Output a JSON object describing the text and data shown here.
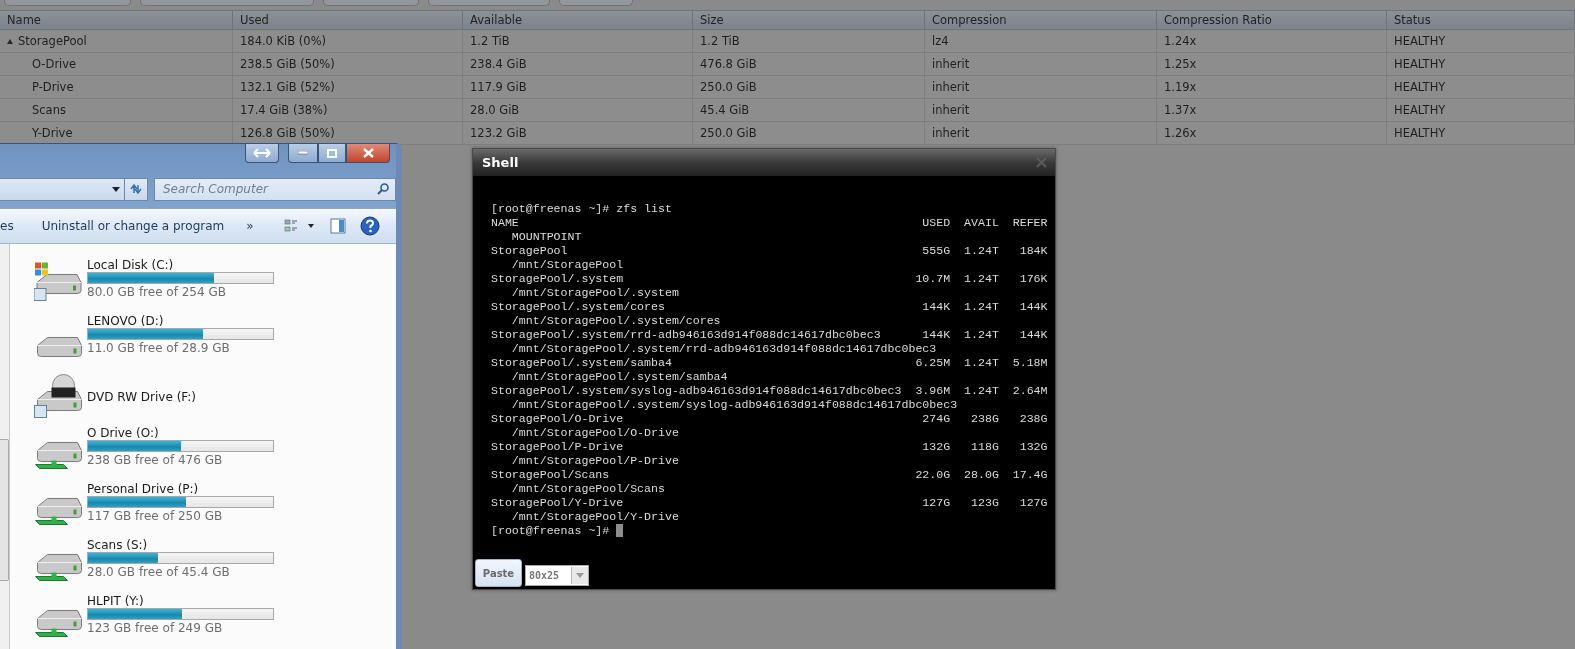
{
  "volumes_table": {
    "columns": [
      "Name",
      "Used",
      "Available",
      "Size",
      "Compression",
      "Compression Ratio",
      "Status"
    ],
    "rows": [
      {
        "cells": [
          "StoragePool",
          "184.0 KiB (0%)",
          "1.2 TiB",
          "1.2 TiB",
          "lz4",
          "1.24x",
          "HEALTHY"
        ],
        "expanded": true,
        "children": [
          {
            "cells": [
              "O-Drive",
              "238.5 GiB (50%)",
              "238.4 GiB",
              "476.8 GiB",
              "inherit",
              "1.25x",
              "HEALTHY"
            ]
          },
          {
            "cells": [
              "P-Drive",
              "132.1 GiB (52%)",
              "117.9 GiB",
              "250.0 GiB",
              "inherit",
              "1.19x",
              "HEALTHY"
            ]
          },
          {
            "cells": [
              "Scans",
              "17.4 GiB (38%)",
              "28.0 GiB",
              "45.4 GiB",
              "inherit",
              "1.37x",
              "HEALTHY"
            ]
          },
          {
            "cells": [
              "Y-Drive",
              "126.8 GiB (50%)",
              "123.2 GiB",
              "250.0 GiB",
              "inherit",
              "1.26x",
              "HEALTHY"
            ]
          }
        ]
      }
    ]
  },
  "explorer": {
    "search": {
      "placeholder": "Search Computer"
    },
    "toolbar": {
      "cut_item": "es",
      "items": [
        "Uninstall or change a program"
      ],
      "overflow": "»"
    },
    "drives": [
      {
        "kind": "system",
        "name": "Local Disk (C:)",
        "level": 0.68,
        "free": "80.0 GB free of 254 GB"
      },
      {
        "kind": "disk",
        "name": "LENOVO (D:)",
        "level": 0.62,
        "free": "11.0 GB free of 28.9 GB"
      },
      {
        "kind": "dvd",
        "name": "DVD RW Drive (F:)"
      },
      {
        "kind": "network",
        "name": "O Drive (O:)",
        "level": 0.5,
        "free": "238 GB free of 476 GB"
      },
      {
        "kind": "network",
        "name": "Personal Drive (P:)",
        "level": 0.53,
        "free": "117 GB free of 250 GB"
      },
      {
        "kind": "network",
        "name": "Scans (S:)",
        "level": 0.38,
        "free": "28.0 GB free of 45.4 GB"
      },
      {
        "kind": "network",
        "name": "HLPIT (Y:)",
        "level": 0.51,
        "free": "123 GB free of 249 GB"
      }
    ]
  },
  "shell": {
    "title": "Shell",
    "prompt": "[root@freenas ~]#",
    "command": "zfs list",
    "header": {
      "name": "NAME",
      "used": "USED",
      "avail": "AVAIL",
      "refer": "REFER",
      "mountpoint": "MOUNTPOINT"
    },
    "datasets": [
      {
        "name": "StoragePool",
        "used": "555G",
        "avail": "1.24T",
        "refer": "184K",
        "mountpoint": "/mnt/StoragePool"
      },
      {
        "name": "StoragePool/.system",
        "used": "10.7M",
        "avail": "1.24T",
        "refer": "176K",
        "mountpoint": "/mnt/StoragePool/.system"
      },
      {
        "name": "StoragePool/.system/cores",
        "used": "144K",
        "avail": "1.24T",
        "refer": "144K",
        "mountpoint": "/mnt/StoragePool/.system/cores"
      },
      {
        "name": "StoragePool/.system/rrd-adb946163d914f088dc14617dbc0bec3",
        "used": "144K",
        "avail": "1.24T",
        "refer": "144K",
        "mountpoint": "/mnt/StoragePool/.system/rrd-adb946163d914f088dc14617dbc0bec3"
      },
      {
        "name": "StoragePool/.system/samba4",
        "used": "6.25M",
        "avail": "1.24T",
        "refer": "5.18M",
        "mountpoint": "/mnt/StoragePool/.system/samba4"
      },
      {
        "name": "StoragePool/.system/syslog-adb946163d914f088dc14617dbc0bec3",
        "used": "3.96M",
        "avail": "1.24T",
        "refer": "2.64M",
        "mountpoint": "/mnt/StoragePool/.system/syslog-adb946163d914f088dc14617dbc0bec3"
      },
      {
        "name": "StoragePool/O-Drive",
        "used": "274G",
        "avail": "238G",
        "refer": "238G",
        "mountpoint": "/mnt/StoragePool/O-Drive"
      },
      {
        "name": "StoragePool/P-Drive",
        "used": "132G",
        "avail": "118G",
        "refer": "132G",
        "mountpoint": "/mnt/StoragePool/P-Drive"
      },
      {
        "name": "StoragePool/Scans",
        "used": "22.0G",
        "avail": "28.0G",
        "refer": "17.4G",
        "mountpoint": "/mnt/StoragePool/Scans"
      },
      {
        "name": "StoragePool/Y-Drive",
        "used": "127G",
        "avail": "123G",
        "refer": "127G",
        "mountpoint": "/mnt/StoragePool/Y-Drive"
      }
    ],
    "final_prompt": "[root@freenas ~]#",
    "paste_button": "Paste",
    "size_select": {
      "value": "80x25"
    }
  }
}
